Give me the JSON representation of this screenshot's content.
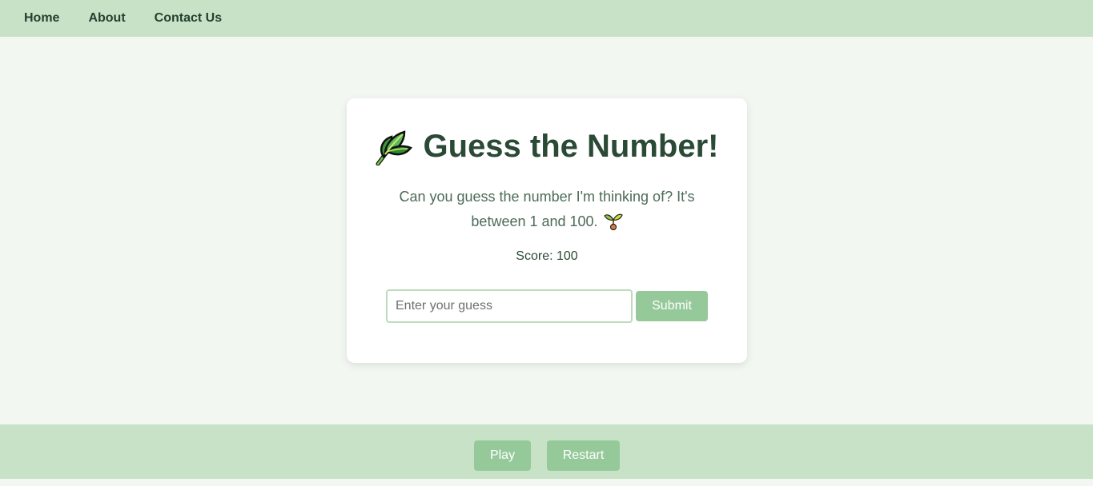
{
  "nav": {
    "items": [
      "Home",
      "About",
      "Contact Us"
    ]
  },
  "card": {
    "title": "Guess the Number!",
    "title_icon": "leaf-icon",
    "description": "Can you guess the number I'm thinking of? It's between 1 and 100.",
    "description_icon": "sprout-icon",
    "score_text": "Score: 100",
    "input": {
      "value": "",
      "placeholder": "Enter your guess"
    },
    "submit_label": "Submit"
  },
  "footer": {
    "play_label": "Play",
    "restart_label": "Restart"
  },
  "colors": {
    "nav_bg": "#c7e2c7",
    "page_bg": "#f2f7f2",
    "button_bg": "#96c99a",
    "text_dark": "#2a4a36"
  }
}
